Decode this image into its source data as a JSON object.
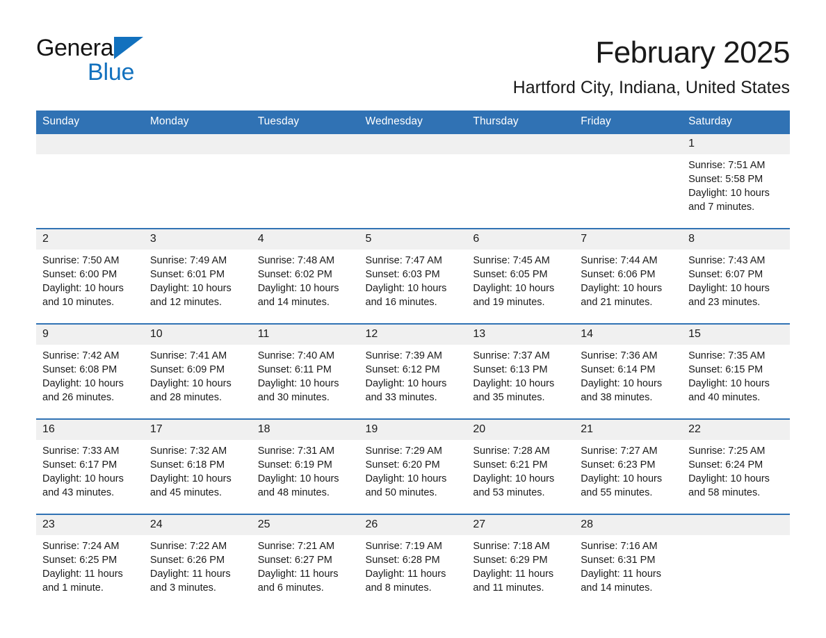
{
  "brand": {
    "word1": "General",
    "word2": "Blue",
    "triangle_color": "#1271BE",
    "text_color": "#141414"
  },
  "header": {
    "title": "February 2025",
    "subtitle": "Hartford City, Indiana, United States"
  },
  "theme": {
    "header_blue": "#3072B4",
    "daynum_gray": "#F0F0F0",
    "brand_blue": "#1271BE",
    "text": "#1a1a1a",
    "background": "#ffffff"
  },
  "weekday_headers": [
    "Sunday",
    "Monday",
    "Tuesday",
    "Wednesday",
    "Thursday",
    "Friday",
    "Saturday"
  ],
  "weeks": [
    [
      {
        "day": "",
        "blank": true
      },
      {
        "day": "",
        "blank": true
      },
      {
        "day": "",
        "blank": true
      },
      {
        "day": "",
        "blank": true
      },
      {
        "day": "",
        "blank": true
      },
      {
        "day": "",
        "blank": true
      },
      {
        "day": "1",
        "sunrise": "Sunrise: 7:51 AM",
        "sunset": "Sunset: 5:58 PM",
        "daylight_line1": "Daylight: 10 hours",
        "daylight_line2": "and 7 minutes."
      }
    ],
    [
      {
        "day": "2",
        "sunrise": "Sunrise: 7:50 AM",
        "sunset": "Sunset: 6:00 PM",
        "daylight_line1": "Daylight: 10 hours",
        "daylight_line2": "and 10 minutes."
      },
      {
        "day": "3",
        "sunrise": "Sunrise: 7:49 AM",
        "sunset": "Sunset: 6:01 PM",
        "daylight_line1": "Daylight: 10 hours",
        "daylight_line2": "and 12 minutes."
      },
      {
        "day": "4",
        "sunrise": "Sunrise: 7:48 AM",
        "sunset": "Sunset: 6:02 PM",
        "daylight_line1": "Daylight: 10 hours",
        "daylight_line2": "and 14 minutes."
      },
      {
        "day": "5",
        "sunrise": "Sunrise: 7:47 AM",
        "sunset": "Sunset: 6:03 PM",
        "daylight_line1": "Daylight: 10 hours",
        "daylight_line2": "and 16 minutes."
      },
      {
        "day": "6",
        "sunrise": "Sunrise: 7:45 AM",
        "sunset": "Sunset: 6:05 PM",
        "daylight_line1": "Daylight: 10 hours",
        "daylight_line2": "and 19 minutes."
      },
      {
        "day": "7",
        "sunrise": "Sunrise: 7:44 AM",
        "sunset": "Sunset: 6:06 PM",
        "daylight_line1": "Daylight: 10 hours",
        "daylight_line2": "and 21 minutes."
      },
      {
        "day": "8",
        "sunrise": "Sunrise: 7:43 AM",
        "sunset": "Sunset: 6:07 PM",
        "daylight_line1": "Daylight: 10 hours",
        "daylight_line2": "and 23 minutes."
      }
    ],
    [
      {
        "day": "9",
        "sunrise": "Sunrise: 7:42 AM",
        "sunset": "Sunset: 6:08 PM",
        "daylight_line1": "Daylight: 10 hours",
        "daylight_line2": "and 26 minutes."
      },
      {
        "day": "10",
        "sunrise": "Sunrise: 7:41 AM",
        "sunset": "Sunset: 6:09 PM",
        "daylight_line1": "Daylight: 10 hours",
        "daylight_line2": "and 28 minutes."
      },
      {
        "day": "11",
        "sunrise": "Sunrise: 7:40 AM",
        "sunset": "Sunset: 6:11 PM",
        "daylight_line1": "Daylight: 10 hours",
        "daylight_line2": "and 30 minutes."
      },
      {
        "day": "12",
        "sunrise": "Sunrise: 7:39 AM",
        "sunset": "Sunset: 6:12 PM",
        "daylight_line1": "Daylight: 10 hours",
        "daylight_line2": "and 33 minutes."
      },
      {
        "day": "13",
        "sunrise": "Sunrise: 7:37 AM",
        "sunset": "Sunset: 6:13 PM",
        "daylight_line1": "Daylight: 10 hours",
        "daylight_line2": "and 35 minutes."
      },
      {
        "day": "14",
        "sunrise": "Sunrise: 7:36 AM",
        "sunset": "Sunset: 6:14 PM",
        "daylight_line1": "Daylight: 10 hours",
        "daylight_line2": "and 38 minutes."
      },
      {
        "day": "15",
        "sunrise": "Sunrise: 7:35 AM",
        "sunset": "Sunset: 6:15 PM",
        "daylight_line1": "Daylight: 10 hours",
        "daylight_line2": "and 40 minutes."
      }
    ],
    [
      {
        "day": "16",
        "sunrise": "Sunrise: 7:33 AM",
        "sunset": "Sunset: 6:17 PM",
        "daylight_line1": "Daylight: 10 hours",
        "daylight_line2": "and 43 minutes."
      },
      {
        "day": "17",
        "sunrise": "Sunrise: 7:32 AM",
        "sunset": "Sunset: 6:18 PM",
        "daylight_line1": "Daylight: 10 hours",
        "daylight_line2": "and 45 minutes."
      },
      {
        "day": "18",
        "sunrise": "Sunrise: 7:31 AM",
        "sunset": "Sunset: 6:19 PM",
        "daylight_line1": "Daylight: 10 hours",
        "daylight_line2": "and 48 minutes."
      },
      {
        "day": "19",
        "sunrise": "Sunrise: 7:29 AM",
        "sunset": "Sunset: 6:20 PM",
        "daylight_line1": "Daylight: 10 hours",
        "daylight_line2": "and 50 minutes."
      },
      {
        "day": "20",
        "sunrise": "Sunrise: 7:28 AM",
        "sunset": "Sunset: 6:21 PM",
        "daylight_line1": "Daylight: 10 hours",
        "daylight_line2": "and 53 minutes."
      },
      {
        "day": "21",
        "sunrise": "Sunrise: 7:27 AM",
        "sunset": "Sunset: 6:23 PM",
        "daylight_line1": "Daylight: 10 hours",
        "daylight_line2": "and 55 minutes."
      },
      {
        "day": "22",
        "sunrise": "Sunrise: 7:25 AM",
        "sunset": "Sunset: 6:24 PM",
        "daylight_line1": "Daylight: 10 hours",
        "daylight_line2": "and 58 minutes."
      }
    ],
    [
      {
        "day": "23",
        "sunrise": "Sunrise: 7:24 AM",
        "sunset": "Sunset: 6:25 PM",
        "daylight_line1": "Daylight: 11 hours",
        "daylight_line2": "and 1 minute."
      },
      {
        "day": "24",
        "sunrise": "Sunrise: 7:22 AM",
        "sunset": "Sunset: 6:26 PM",
        "daylight_line1": "Daylight: 11 hours",
        "daylight_line2": "and 3 minutes."
      },
      {
        "day": "25",
        "sunrise": "Sunrise: 7:21 AM",
        "sunset": "Sunset: 6:27 PM",
        "daylight_line1": "Daylight: 11 hours",
        "daylight_line2": "and 6 minutes."
      },
      {
        "day": "26",
        "sunrise": "Sunrise: 7:19 AM",
        "sunset": "Sunset: 6:28 PM",
        "daylight_line1": "Daylight: 11 hours",
        "daylight_line2": "and 8 minutes."
      },
      {
        "day": "27",
        "sunrise": "Sunrise: 7:18 AM",
        "sunset": "Sunset: 6:29 PM",
        "daylight_line1": "Daylight: 11 hours",
        "daylight_line2": "and 11 minutes."
      },
      {
        "day": "28",
        "sunrise": "Sunrise: 7:16 AM",
        "sunset": "Sunset: 6:31 PM",
        "daylight_line1": "Daylight: 11 hours",
        "daylight_line2": "and 14 minutes."
      },
      {
        "day": "",
        "blank": true
      }
    ]
  ]
}
